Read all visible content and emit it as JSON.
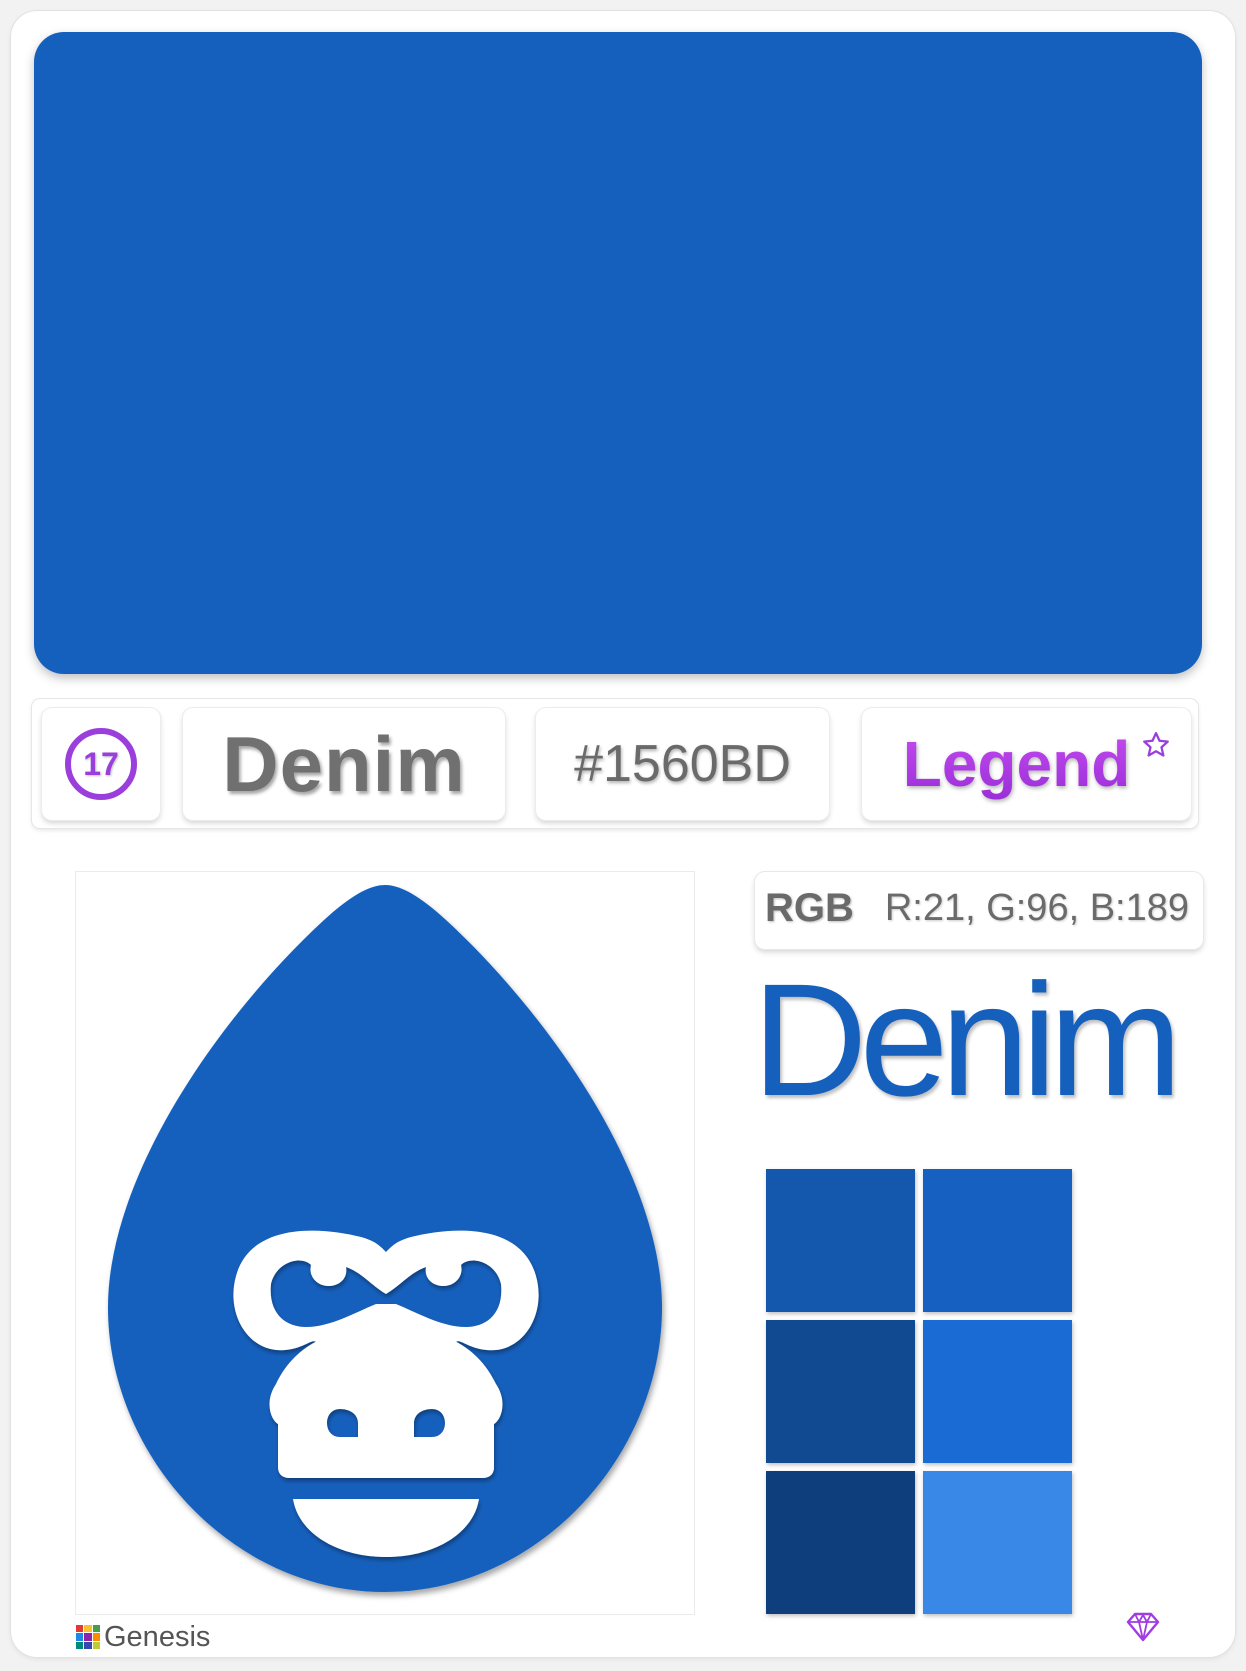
{
  "color": {
    "name": "Denim",
    "hex": "#1560BD",
    "index": "17",
    "tier": "Legend",
    "rgb_label": "RGB",
    "rgb_value": "R:21, G:96, B:189"
  },
  "colors": {
    "main": "#1560BD",
    "accent_purple": "#9A3FDC",
    "text_gray": "#707070"
  },
  "shades": [
    {
      "color": "#1458AE"
    },
    {
      "color": "#1660C1"
    },
    {
      "color": "#124A91"
    },
    {
      "color": "#1A6BD4"
    },
    {
      "color": "#0F3E7C"
    },
    {
      "color": "#3988E8"
    }
  ],
  "icons": {
    "tier_badge": "star-outline-icon",
    "logo": "drop-gorilla-icon",
    "brand": "grid-squares-icon",
    "footer": "gem-icon"
  },
  "footer": {
    "brand_name": "Genesis"
  }
}
